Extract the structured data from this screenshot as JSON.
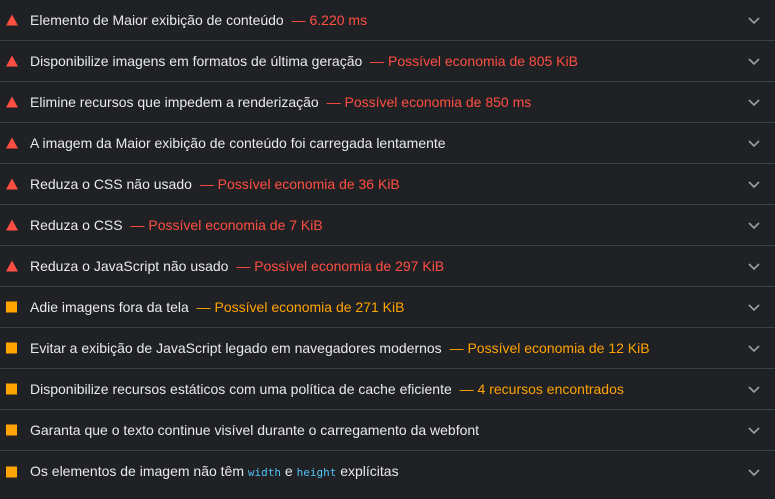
{
  "colors": {
    "background": "#202124",
    "fail": "#ff4e42",
    "average": "#ffa400",
    "text": "#e8eaed",
    "code": "#4fc3f7"
  },
  "audits": [
    {
      "status": "fail",
      "title": "Elemento de Maior exibição de conteúdo",
      "display_value": "— 6.220 ms",
      "icon": "fail-triangle-icon"
    },
    {
      "status": "fail",
      "title": "Disponibilize imagens em formatos de última geração",
      "display_value": "— Possível economia de 805 KiB",
      "icon": "fail-triangle-icon"
    },
    {
      "status": "fail",
      "title": "Elimine recursos que impedem a renderização",
      "display_value": "— Possível economia de 850 ms",
      "icon": "fail-triangle-icon"
    },
    {
      "status": "fail",
      "title": "A imagem da Maior exibição de conteúdo foi carregada lentamente",
      "display_value": "",
      "icon": "fail-triangle-icon"
    },
    {
      "status": "fail",
      "title": "Reduza o CSS não usado",
      "display_value": "— Possível economia de 36 KiB",
      "icon": "fail-triangle-icon"
    },
    {
      "status": "fail",
      "title": "Reduza o CSS",
      "display_value": "— Possível economia de 7 KiB",
      "icon": "fail-triangle-icon"
    },
    {
      "status": "fail",
      "title": "Reduza o JavaScript não usado",
      "display_value": "— Possível economia de 297 KiB",
      "icon": "fail-triangle-icon"
    },
    {
      "status": "average",
      "title": "Adie imagens fora da tela",
      "display_value": "— Possível economia de 271 KiB",
      "icon": "average-square-icon"
    },
    {
      "status": "average",
      "title": "Evitar a exibição de JavaScript legado em navegadores modernos",
      "display_value": "— Possível economia de 12 KiB",
      "icon": "average-square-icon"
    },
    {
      "status": "average",
      "title": "Disponibilize recursos estáticos com uma política de cache eficiente",
      "display_value": "— 4 recursos encontrados",
      "icon": "average-square-icon"
    },
    {
      "status": "average",
      "title": "Garanta que o texto continue visível durante o carregamento da webfont",
      "display_value": "",
      "icon": "average-square-icon"
    },
    {
      "status": "average",
      "title_parts": [
        "Os elementos de imagem não têm ",
        "width",
        " e ",
        "height",
        " explícitas"
      ],
      "display_value": "",
      "icon": "average-square-icon"
    }
  ]
}
